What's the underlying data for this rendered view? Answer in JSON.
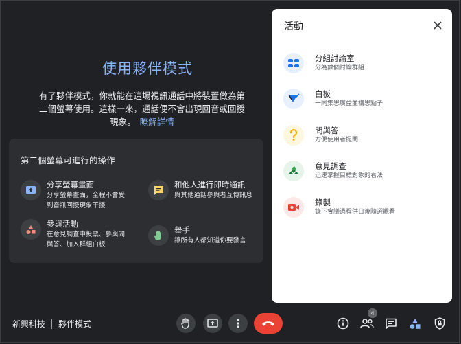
{
  "companion": {
    "title": "使用夥伴模式",
    "desc_line1": "有了夥伴模式，你就能在這場視訊通話中將裝置做為第",
    "desc_line2": "二個螢幕使用。這樣一來，通話便不會出現回音或回授",
    "desc_line3": "現象。",
    "learn_more": "瞭解詳情"
  },
  "card": {
    "title": "第二個螢幕可進行的操作",
    "features": [
      {
        "title": "分享螢幕畫面",
        "desc": "分享螢幕畫面，全程不會受\n到音訊回授現象干擾",
        "icon": "present-screen-icon"
      },
      {
        "title": "和他人進行即時通訊",
        "desc": "與其他通話參與者互傳訊息",
        "icon": "chat-icon"
      },
      {
        "title": "參與活動",
        "desc": "在意見調查中投票、參與問\n與答、加入群組白板",
        "icon": "activities-icon"
      },
      {
        "title": "舉手",
        "desc": "讓所有人都知道你要發言",
        "icon": "hand-icon"
      }
    ]
  },
  "meeting": {
    "org": "新興科技",
    "mode": "夥伴模式"
  },
  "controls": {
    "people_count": "4"
  },
  "panel": {
    "title": "活動",
    "items": [
      {
        "title": "分組討論室",
        "desc": "分為數個討論群組",
        "icon": "breakout-rooms-icon"
      },
      {
        "title": "白板",
        "desc": "一同集思廣益並構思點子",
        "icon": "whiteboard-icon"
      },
      {
        "title": "問與答",
        "desc": "方便使用者提問",
        "icon": "qa-icon"
      },
      {
        "title": "意見調查",
        "desc": "迅速掌握目標對象的看法",
        "icon": "polls-icon"
      },
      {
        "title": "錄製",
        "desc": "錄下會議過程供日後隨選觀看",
        "icon": "record-icon"
      }
    ]
  },
  "colors": {
    "accent": "#8ab4f8",
    "background": "#202124",
    "end_call": "#ea4335"
  }
}
